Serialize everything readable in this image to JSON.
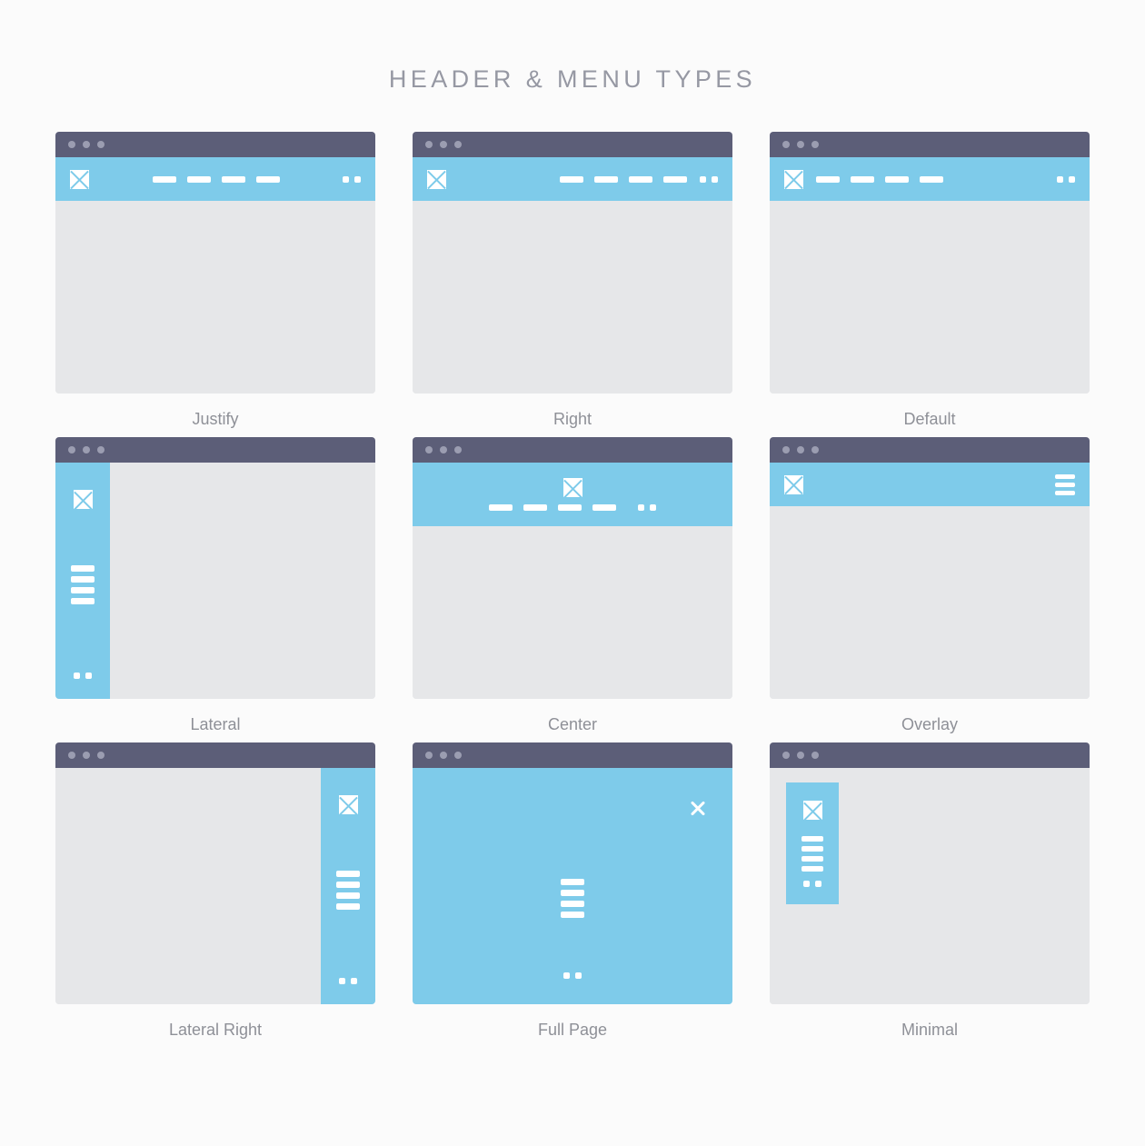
{
  "page": {
    "title": "HEADER & MENU TYPES",
    "background_color": "#fbfbfb"
  },
  "colors": {
    "titlebar": "#5c5e78",
    "titlebar_dot": "#9b9db1",
    "accent_blue": "#7ecbea",
    "content_gray": "#e6e7e9",
    "caption_text": "#8e9097",
    "heading_text": "#9698a3",
    "element_white": "#ffffff"
  },
  "mockups": [
    {
      "id": "justify",
      "caption": "Justify",
      "layout": "top-header",
      "menu_alignment": "justify",
      "logo": "image-placeholder-icon",
      "menu_items": 4,
      "utility_dots": 2
    },
    {
      "id": "right",
      "caption": "Right",
      "layout": "top-header",
      "menu_alignment": "right",
      "logo": "image-placeholder-icon",
      "menu_items": 4,
      "utility_dots": 2
    },
    {
      "id": "default",
      "caption": "Default",
      "layout": "top-header",
      "menu_alignment": "left",
      "logo": "image-placeholder-icon",
      "menu_items": 4,
      "utility_dots": 2
    },
    {
      "id": "lateral",
      "caption": "Lateral",
      "layout": "sidebar-left",
      "menu_alignment": "vertical",
      "logo": "image-placeholder-icon",
      "menu_items": 4,
      "utility_dots": 2
    },
    {
      "id": "center",
      "caption": "Center",
      "layout": "top-header-stacked",
      "menu_alignment": "center",
      "logo": "image-placeholder-icon",
      "menu_items": 4,
      "utility_dots": 2
    },
    {
      "id": "overlay",
      "caption": "Overlay",
      "layout": "top-header",
      "menu_alignment": "hamburger-right",
      "logo": "image-placeholder-icon",
      "menu_items": 0,
      "utility_dots": 0
    },
    {
      "id": "lateral-right",
      "caption": "Lateral Right",
      "layout": "sidebar-right",
      "menu_alignment": "vertical",
      "logo": "image-placeholder-icon",
      "menu_items": 4,
      "utility_dots": 2
    },
    {
      "id": "full-page",
      "caption": "Full Page",
      "layout": "fullscreen-overlay",
      "menu_alignment": "center",
      "logo": "none",
      "menu_items": 4,
      "utility_dots": 2,
      "close_icon": "close-x-icon"
    },
    {
      "id": "minimal",
      "caption": "Minimal",
      "layout": "floating-panel",
      "menu_alignment": "vertical",
      "logo": "image-placeholder-icon",
      "menu_items": 4,
      "utility_dots": 2
    }
  ]
}
